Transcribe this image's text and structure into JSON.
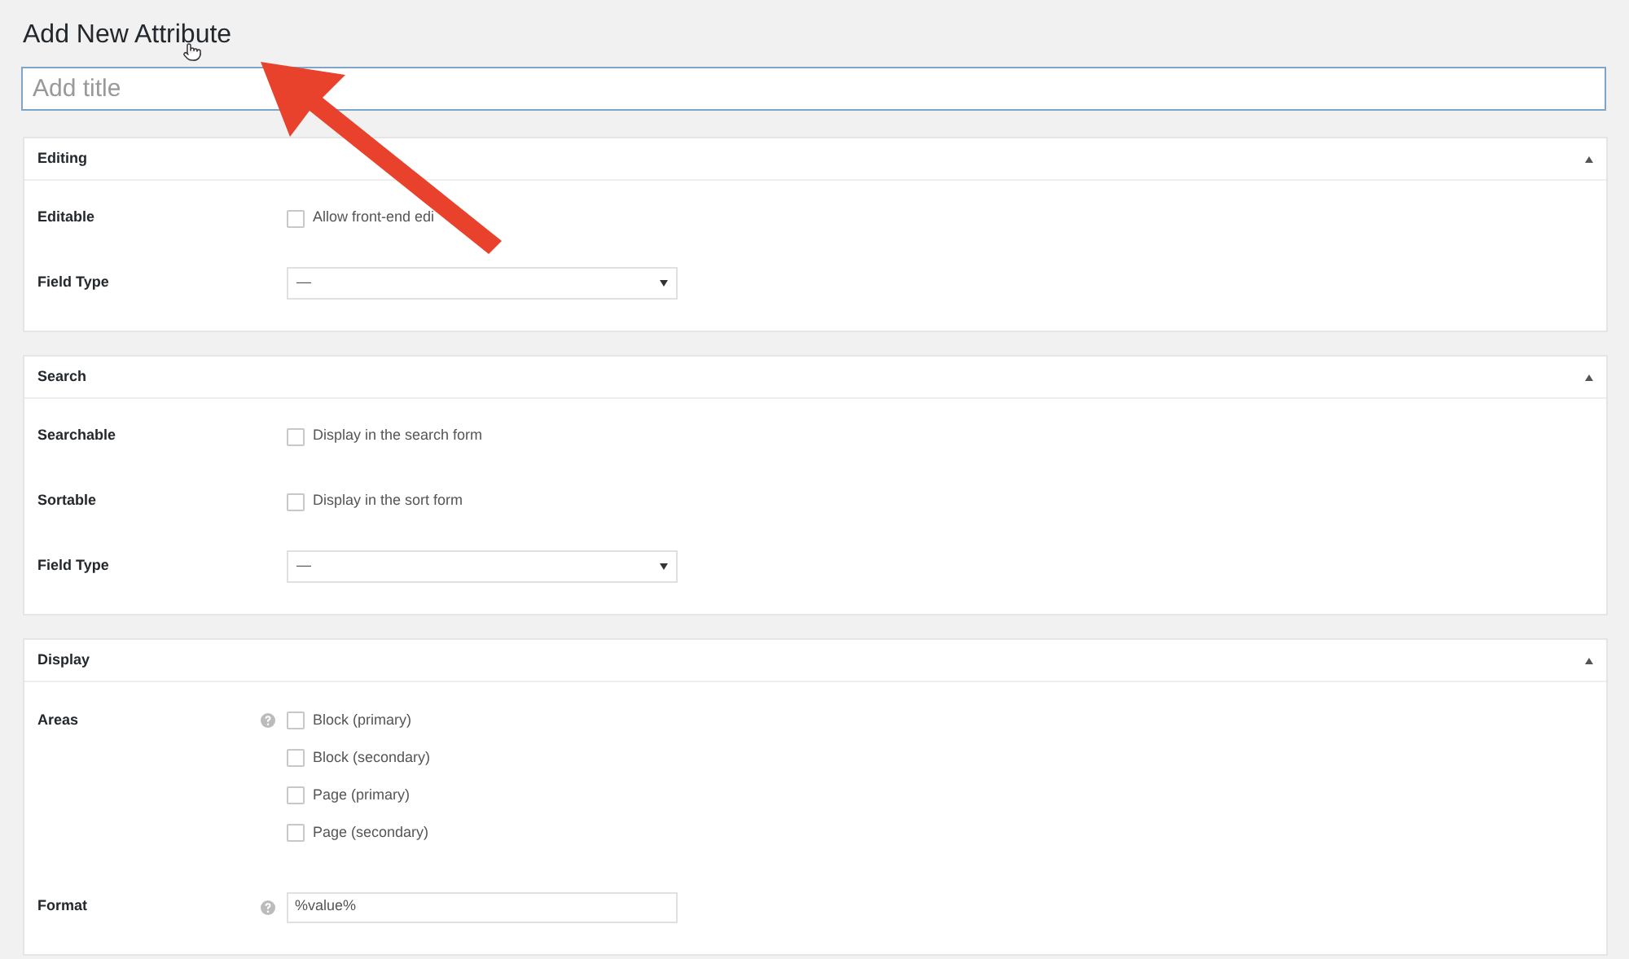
{
  "page_title": "Add New Attribute",
  "title_field": {
    "placeholder": "Add title"
  },
  "panels": [
    {
      "title": "Editing",
      "expanded": true,
      "rows": [
        {
          "kind": "checkbox",
          "label": "Editable",
          "help": false,
          "options": [
            {
              "label": "Allow front-end edi",
              "checked": false
            }
          ]
        },
        {
          "kind": "select",
          "label": "Field Type",
          "help": false,
          "value": "—"
        }
      ]
    },
    {
      "title": "Search",
      "expanded": true,
      "rows": [
        {
          "kind": "checkbox",
          "label": "Searchable",
          "help": false,
          "options": [
            {
              "label": "Display in the search form",
              "checked": false
            }
          ]
        },
        {
          "kind": "checkbox",
          "label": "Sortable",
          "help": false,
          "options": [
            {
              "label": "Display in the sort form",
              "checked": false
            }
          ]
        },
        {
          "kind": "select",
          "label": "Field Type",
          "help": false,
          "value": "—"
        }
      ]
    },
    {
      "title": "Display",
      "expanded": true,
      "rows": [
        {
          "kind": "checkbox",
          "label": "Areas",
          "help": true,
          "options": [
            {
              "label": "Block (primary)",
              "checked": false
            },
            {
              "label": "Block (secondary)",
              "checked": false
            },
            {
              "label": "Page (primary)",
              "checked": false
            },
            {
              "label": "Page (secondary)",
              "checked": false
            }
          ]
        },
        {
          "kind": "text",
          "label": "Format",
          "help": true,
          "value": "%value%"
        }
      ]
    }
  ]
}
